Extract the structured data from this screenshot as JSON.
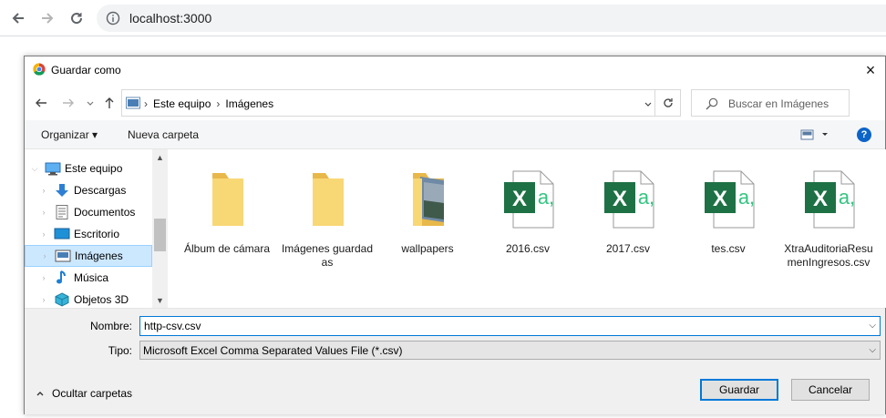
{
  "browser": {
    "url": "localhost:3000"
  },
  "dialog": {
    "title": "Guardar como",
    "close_icon": "×"
  },
  "address": {
    "crumbs": [
      "Este equipo",
      "Imágenes"
    ],
    "search_placeholder": "Buscar en Imágenes"
  },
  "toolbar": {
    "organize": "Organizar ▾",
    "new_folder": "Nueva carpeta",
    "help": "?"
  },
  "sidebar": {
    "items": [
      {
        "label": "Este equipo",
        "icon": "computer-icon"
      },
      {
        "label": "Descargas",
        "icon": "download-arrow-icon"
      },
      {
        "label": "Documentos",
        "icon": "document-icon"
      },
      {
        "label": "Escritorio",
        "icon": "desktop-icon"
      },
      {
        "label": "Imágenes",
        "icon": "pictures-icon"
      },
      {
        "label": "Música",
        "icon": "music-note-icon"
      },
      {
        "label": "Objetos 3D",
        "icon": "cube-icon"
      }
    ]
  },
  "files": [
    {
      "name": "Álbum de cámara",
      "type": "folder"
    },
    {
      "name": "Imágenes guardadas",
      "type": "folder"
    },
    {
      "name": "wallpapers",
      "type": "folder-photo"
    },
    {
      "name": "2016.csv",
      "type": "excel-csv"
    },
    {
      "name": "2017.csv",
      "type": "excel-csv"
    },
    {
      "name": "tes.csv",
      "type": "excel-csv"
    },
    {
      "name": "XtraAuditoriaResumenIngresos.csv",
      "type": "excel-csv"
    }
  ],
  "form": {
    "name_label": "Nombre:",
    "name_value": "http-csv.csv",
    "type_label": "Tipo:",
    "type_value": "Microsoft Excel Comma Separated Values File (*.csv)",
    "hide_folders": "Ocultar carpetas",
    "save": "Guardar",
    "cancel": "Cancelar"
  },
  "colors": {
    "accent": "#0078d7",
    "folder": "#f8d775",
    "excel": "#1e7145",
    "selected": "#cce8ff"
  }
}
